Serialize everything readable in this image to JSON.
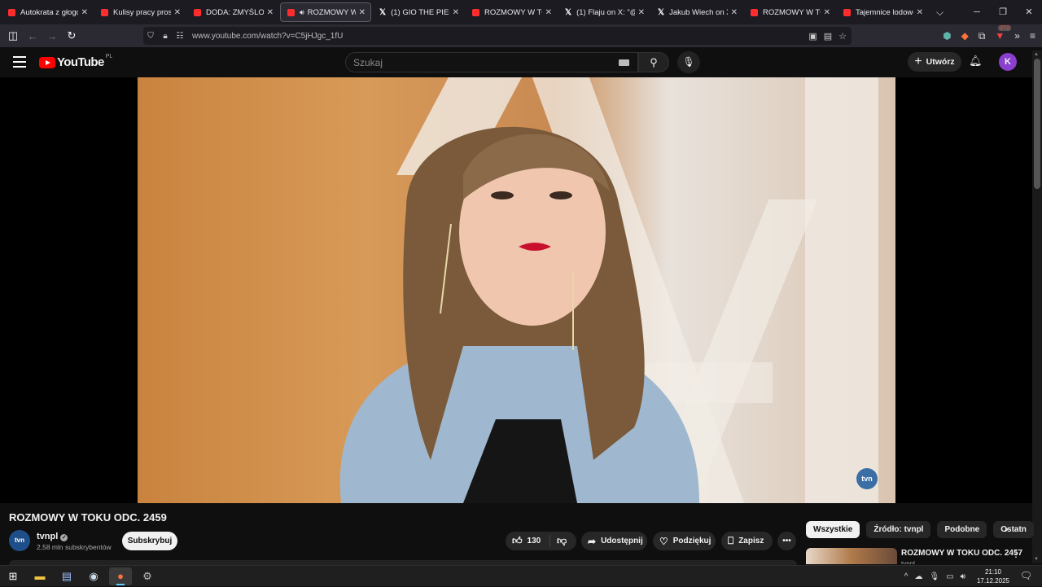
{
  "browser": {
    "tabs": [
      {
        "title": "Autokrata z głogowsk",
        "icon": "youtube-icon",
        "active": false
      },
      {
        "title": "Kulisy pracy prostytu",
        "icon": "youtube-icon",
        "active": false
      },
      {
        "title": "DODA: ZMYŚLONE Z",
        "icon": "youtube-icon",
        "active": false
      },
      {
        "title": "ROZMOWY W TO",
        "icon": "youtube-icon",
        "active": true,
        "audio": true
      },
      {
        "title": "(1) GIO THE PIEKIELN",
        "icon": "x-icon",
        "active": false
      },
      {
        "title": "ROZMOWY W TOKU",
        "icon": "youtube-icon",
        "active": false
      },
      {
        "title": "(1) Flaju on X: \"@ma",
        "icon": "x-icon",
        "active": false
      },
      {
        "title": "Jakub Wiech on X: \"Z",
        "icon": "x-icon",
        "active": false
      },
      {
        "title": "ROZMOWY W TOKU",
        "icon": "youtube-icon",
        "active": false
      },
      {
        "title": "Tajemnice lodowca -",
        "icon": "youtube-icon",
        "active": false
      }
    ],
    "url": "www.youtube.com/watch?v=C5jHJgc_1fU",
    "extension_badge": "272"
  },
  "youtube": {
    "logo": "YouTube",
    "region": "PL",
    "search_placeholder": "Szukaj",
    "create_label": "Utwórz",
    "avatar_letter": "K",
    "video": {
      "title": "ROZMOWY W TOKU ODC. 2459",
      "watermark": "tvn"
    },
    "channel": {
      "avatar_text": "tvn",
      "name": "tvnpl",
      "subscribers": "2,58 mln subskrybentów",
      "subscribe_label": "Subskrybuj"
    },
    "actions": {
      "likes": "130",
      "share": "Udostępnij",
      "thanks": "Podziękuj",
      "save": "Zapisz"
    },
    "chips": [
      "Wszystkie",
      "Źródło: tvnpl",
      "Podobne",
      "Ostatn"
    ],
    "recommendation": {
      "title": "ROZMOWY W TOKU ODC. 2457",
      "channel": "tvnpl"
    }
  },
  "taskbar": {
    "time": "21:10",
    "date": "17.12.2025"
  },
  "colors": {
    "accent_red": "#ff0000",
    "background": "#0f0f0f",
    "avatar_purple": "#8a3fcf"
  }
}
